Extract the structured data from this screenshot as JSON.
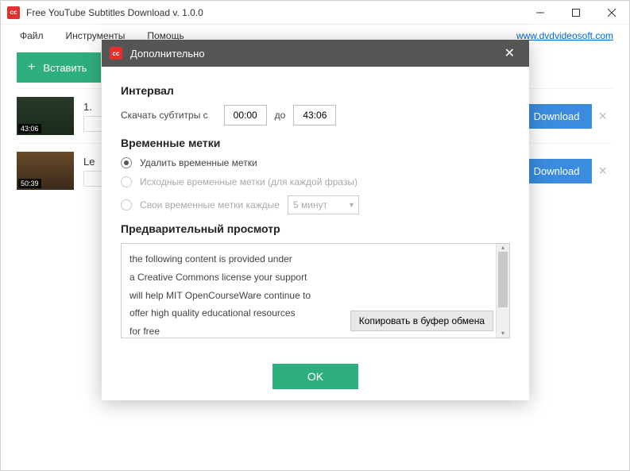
{
  "window": {
    "title": "Free YouTube Subtitles Download v. 1.0.0",
    "app_icon_text": "cc"
  },
  "menu": {
    "file": "Файл",
    "tools": "Инструменты",
    "help": "Помощь",
    "link": "www.dvdvideosoft.com"
  },
  "toolbar": {
    "paste_label": "Вставить"
  },
  "list": [
    {
      "title_prefix": "1.",
      "duration": "43:06",
      "download_label": "Download"
    },
    {
      "title_prefix": "Le",
      "duration": "50:39",
      "download_label": "Download"
    }
  ],
  "modal": {
    "title": "Дополнительно",
    "section_interval": "Интервал",
    "interval_label": "Скачать субтитры с",
    "interval_from": "00:00",
    "interval_to_label": "до",
    "interval_to": "43:06",
    "section_timestamps": "Временные метки",
    "ts_option_remove": "Удалить временные метки",
    "ts_option_original": "Исходные временные метки (для каждой фразы)",
    "ts_option_custom": "Свои временные метки каждые",
    "ts_custom_value": "5 минут",
    "section_preview": "Предварительный просмотр",
    "preview_lines": [
      "the following content is provided under",
      "a Creative Commons license your support",
      "will help MIT OpenCourseWare continue to",
      "offer high quality educational resources",
      "for free"
    ],
    "copy_label": "Копировать в буфер обмена",
    "ok_label": "OK"
  }
}
